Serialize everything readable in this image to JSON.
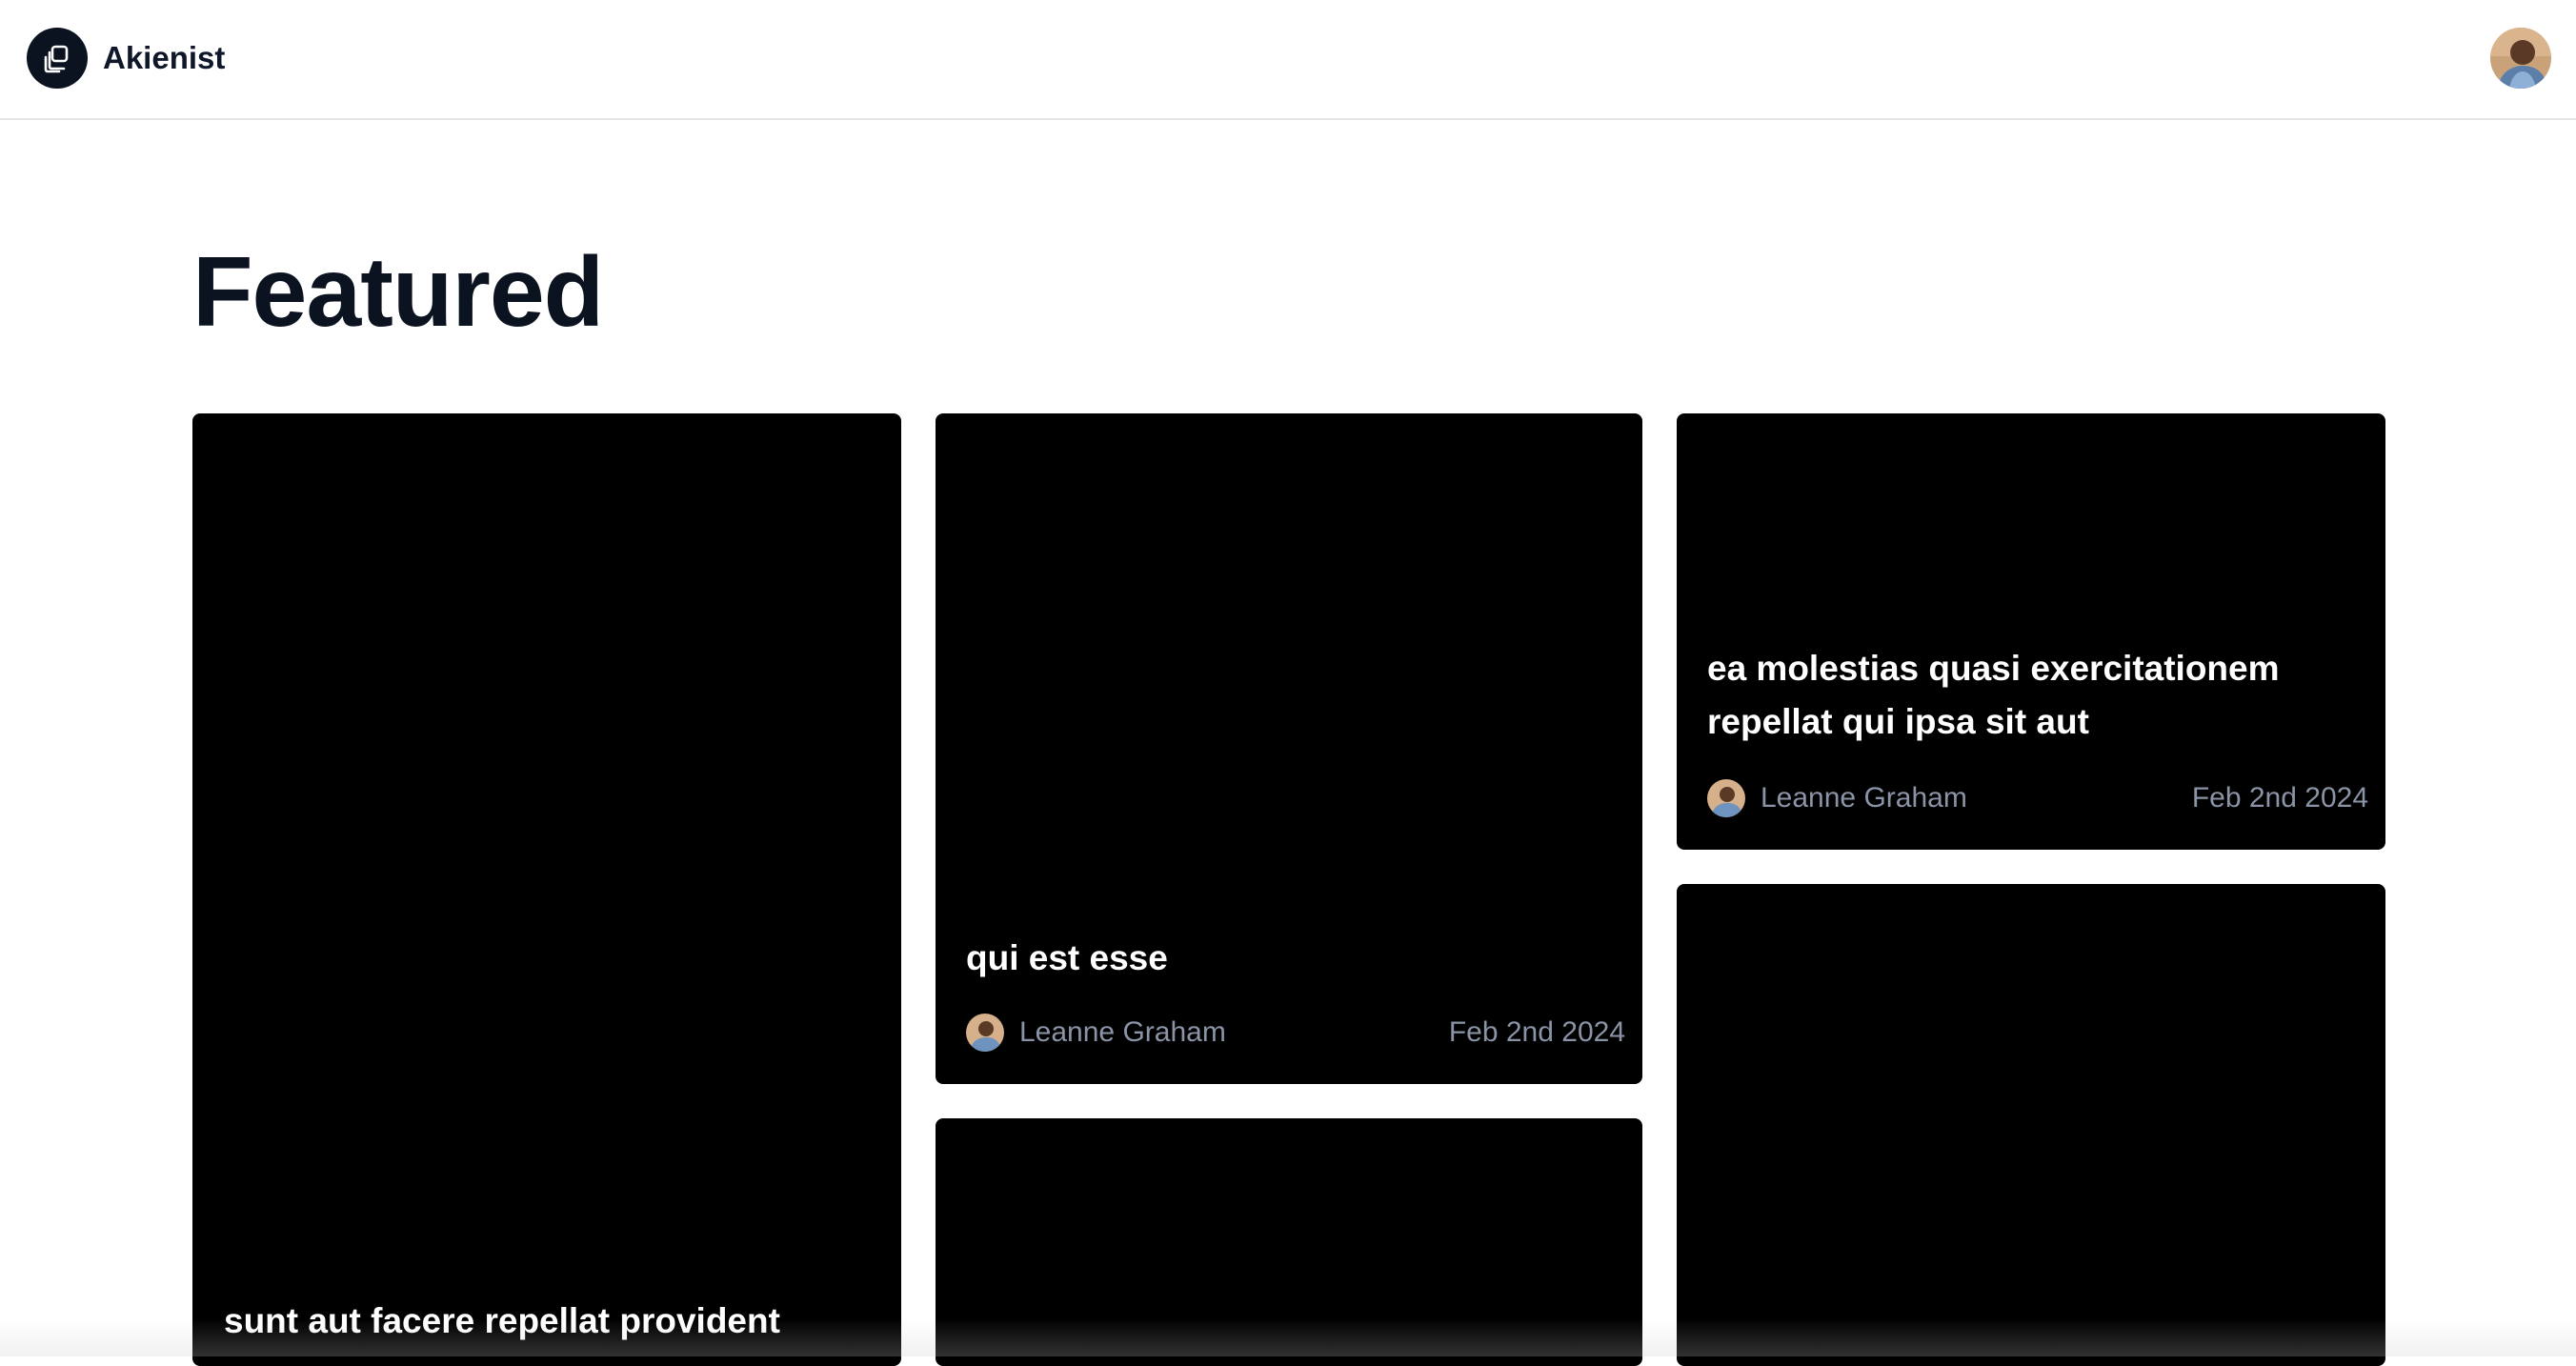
{
  "header": {
    "brand": "Akienist",
    "logo_icon": "stacked-squares-icon",
    "user_avatar_icon": "user-avatar"
  },
  "main": {
    "title": "Featured"
  },
  "cards": [
    {
      "title": "sunt aut facere repellat provident",
      "author": "",
      "date": ""
    },
    {
      "title": "qui est esse",
      "author": "Leanne Graham",
      "date": "Feb 2nd 2024"
    },
    {
      "title": "ea molestias quasi exercitationem repellat qui ipsa sit aut",
      "author": "Leanne Graham",
      "date": "Feb 2nd 2024"
    },
    {
      "title": "",
      "author": "",
      "date": ""
    },
    {
      "title": "",
      "author": "",
      "date": ""
    }
  ],
  "colors": {
    "card_bg": "#000000",
    "logo_bg": "#0b1220",
    "meta_text": "#8a94a6"
  }
}
